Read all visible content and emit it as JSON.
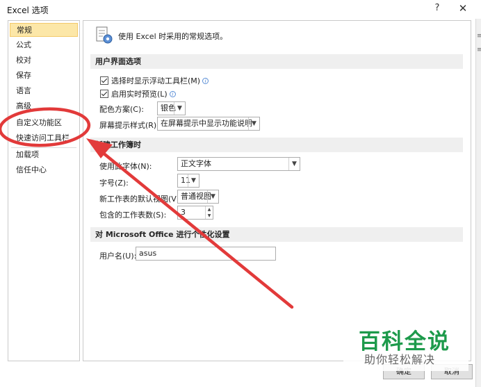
{
  "window": {
    "title": "Excel 选项",
    "help": "?",
    "close": "✕"
  },
  "nav": {
    "items": [
      {
        "label": "常规",
        "selected": true
      },
      {
        "label": "公式"
      },
      {
        "label": "校对"
      },
      {
        "label": "保存"
      },
      {
        "label": "语言"
      },
      {
        "label": "高级"
      },
      {
        "label": "自定义功能区"
      },
      {
        "label": "快速访问工具栏"
      },
      {
        "label": "加载项"
      },
      {
        "label": "信任中心"
      }
    ]
  },
  "main": {
    "intro": "使用 Excel 时采用的常规选项。",
    "ui_section": {
      "header": "用户界面选项",
      "mini_toolbar": "选择时显示浮动工具栏(M)",
      "live_preview": "启用实时预览(L)",
      "color_scheme_label": "配色方案(C):",
      "color_scheme_value": "银色",
      "screentip_label": "屏幕提示样式(R):",
      "screentip_value": "在屏幕提示中显示功能说明"
    },
    "new_wb_section": {
      "header": "新建工作簿时",
      "font_label": "使用此字体(N):",
      "font_value": "正文字体",
      "size_label": "字号(Z):",
      "size_value": "11",
      "view_label": "新工作表的默认视图(V):",
      "view_value": "普通视图",
      "sheets_label": "包含的工作表数(S):",
      "sheets_value": "3"
    },
    "personal_section": {
      "header": "对 Microsoft Office 进行个性化设置",
      "username_label": "用户名(U):",
      "username_value": "asus"
    }
  },
  "buttons": {
    "ok": "确定",
    "cancel": "取消"
  },
  "watermark": {
    "brand": "百科全说",
    "slogan": "助你轻松解决"
  },
  "colors": {
    "annotation_red": "#e23a3a",
    "watermark_green": "#1d9a4b",
    "selected_bg": "#fce7a8"
  },
  "icons": {
    "general": "options-gear-icon",
    "info": "info-icon",
    "dropdown": "chevron-down-icon"
  }
}
